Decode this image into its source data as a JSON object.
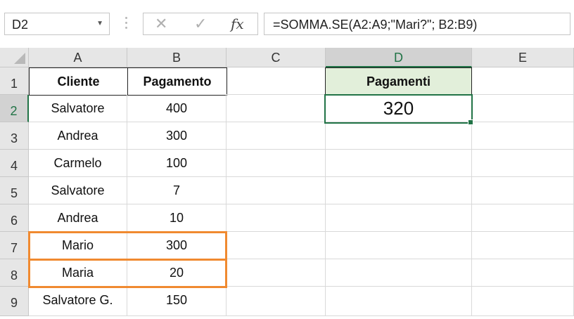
{
  "name_box": {
    "value": "D2",
    "dropdown_icon": "chevron-down-icon"
  },
  "formula_buttons": {
    "cancel": "✕",
    "enter": "✓",
    "fx": "fx"
  },
  "formula": {
    "value": "=SOMMA.SE(A2:A9;\"Mari?\"; B2:B9)"
  },
  "columns": [
    "A",
    "B",
    "C",
    "D",
    "E"
  ],
  "selected_column": "D",
  "rows": [
    "1",
    "2",
    "3",
    "4",
    "5",
    "6",
    "7",
    "8",
    "9"
  ],
  "selected_row": "2",
  "table": {
    "headers": {
      "cliente": "Cliente",
      "pagamento": "Pagamento"
    },
    "rows": [
      {
        "cliente": "Salvatore",
        "pagamento": "400"
      },
      {
        "cliente": "Andrea",
        "pagamento": "300"
      },
      {
        "cliente": "Carmelo",
        "pagamento": "100"
      },
      {
        "cliente": "Salvatore",
        "pagamento": "7"
      },
      {
        "cliente": "Andrea",
        "pagamento": "10"
      },
      {
        "cliente": "Mario",
        "pagamento": "300"
      },
      {
        "cliente": "Maria",
        "pagamento": "20"
      },
      {
        "cliente": "Salvatore G.",
        "pagamento": "150"
      }
    ]
  },
  "result": {
    "header": "Pagamenti",
    "value": "320",
    "header_bg": "#e2efda"
  },
  "highlight_color": "#f08a30",
  "accent_color": "#217346"
}
